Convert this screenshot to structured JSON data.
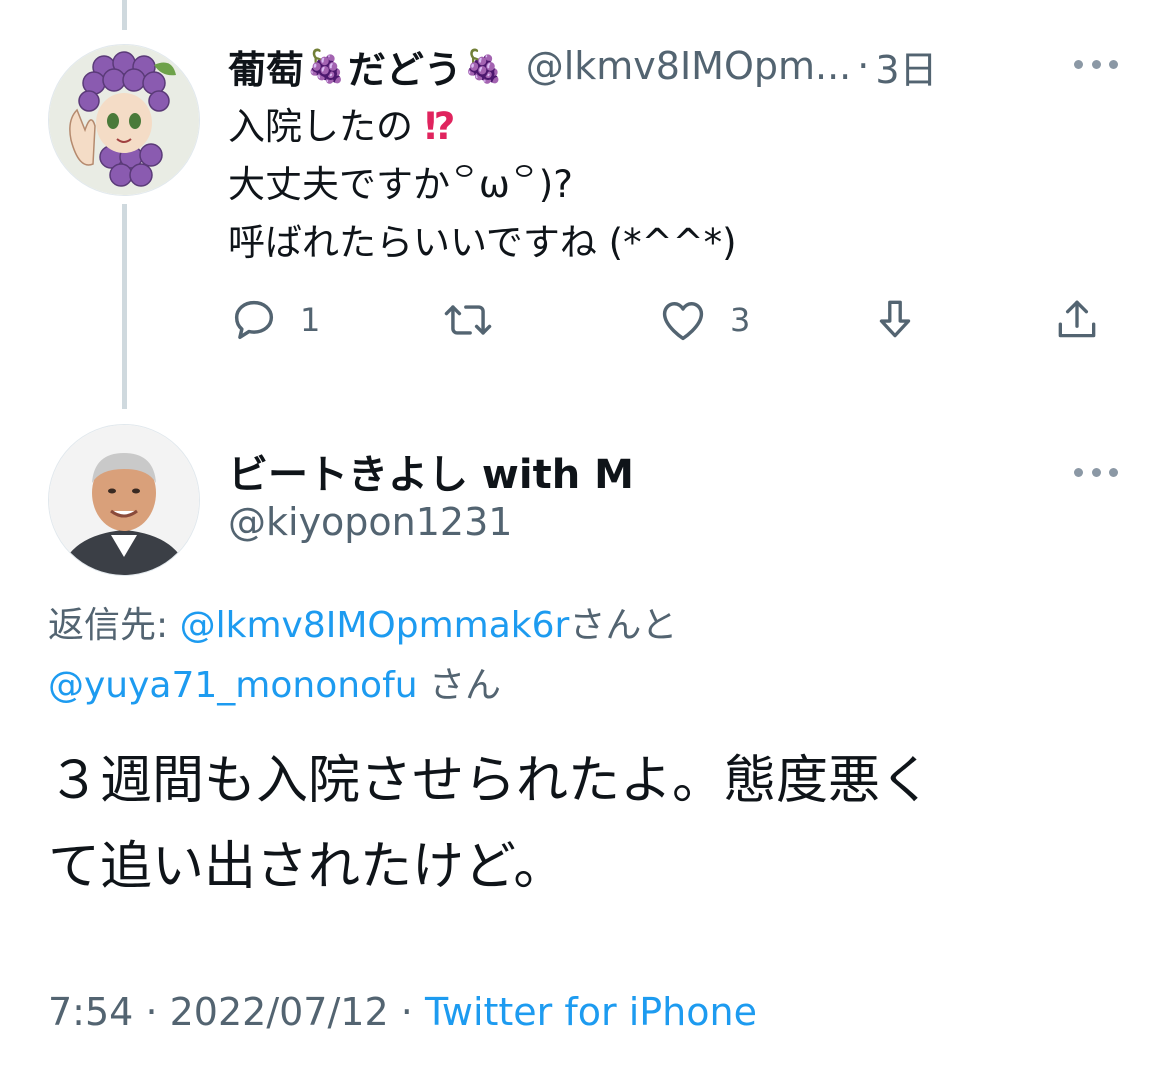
{
  "reply": {
    "name_part1": "葡萄",
    "name_part2": "だどう",
    "grape_emoji": "🍇",
    "handle": "@lkmv8IMOpm...",
    "separator": "·",
    "time": "3日",
    "lines": [
      "入院したの",
      "大丈夫ですか꒪ω꒪)?",
      "呼ばれたらいいですね (*^^*)"
    ],
    "exclaim": "⁉",
    "actions": {
      "reply_count": "1",
      "retweet_count": "",
      "like_count": "3"
    }
  },
  "tweet": {
    "display_name": "ビートきよし with M",
    "handle": "@kiyopon1231",
    "replying_label": "返信先:",
    "mention_1": "@lkmv8IMOpmmak6r",
    "mention_1_suffix": "さんと",
    "mention_2": "@yuya71_mononofu",
    "mention_2_suffix": "さん",
    "text_lines": [
      "３週間も入院させられたよ。態度悪く",
      "て追い出されたけど。"
    ],
    "time": "7:54",
    "date": "2022/07/12",
    "separator": "·",
    "source": "Twitter for iPhone"
  },
  "colors": {
    "text": "#0f1419",
    "secondary": "#536471",
    "link": "#1d9bf0",
    "thread_line": "#cfd9de",
    "exclaim": "#e0245e"
  },
  "icons": [
    "more-icon",
    "reply-icon",
    "retweet-icon",
    "like-icon",
    "bookmark-download-icon",
    "share-icon"
  ]
}
